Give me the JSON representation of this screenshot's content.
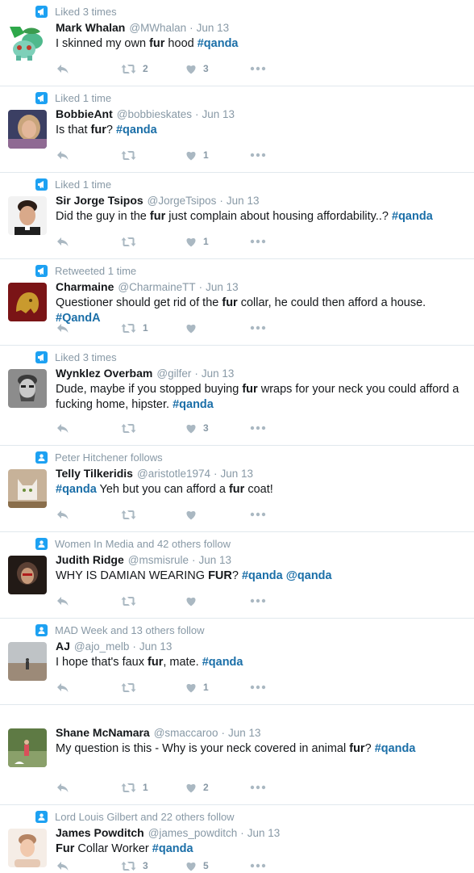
{
  "colors": {
    "accent": "#1da1f2",
    "hashtag": "#1b6fa8",
    "muted": "#8899a6",
    "icon": "#aab8c2"
  },
  "tweets": [
    {
      "context_icon": "bullhorn-icon",
      "context": "Liked 3 times",
      "name": "Mark Whalan",
      "handle": "@MWhalan",
      "time": "Jun 13",
      "avatar": "bulbasaur-avatar",
      "body": [
        [
          "t",
          "I skinned my own  "
        ],
        [
          "k",
          "fur"
        ],
        [
          "t",
          " hood "
        ],
        [
          "h",
          "#qanda"
        ]
      ],
      "retweets": "2",
      "likes": "3"
    },
    {
      "context_icon": "bullhorn-icon",
      "context": "Liked 1 time",
      "name": "BobbieAnt",
      "handle": "@bobbieskates",
      "time": "Jun 13",
      "avatar": "woman-portrait-avatar",
      "body": [
        [
          "t",
          "Is that "
        ],
        [
          "k",
          "fur"
        ],
        [
          "t",
          "? "
        ],
        [
          "h",
          "#qanda"
        ]
      ],
      "retweets": "",
      "likes": "1"
    },
    {
      "context_icon": "bullhorn-icon",
      "context": "Liked 1 time",
      "name": "Sir Jorge Tsipos",
      "handle": "@JorgeTsipos",
      "time": "Jun 13",
      "avatar": "man-portrait-avatar",
      "body": [
        [
          "t",
          "Did the guy in the "
        ],
        [
          "k",
          "fur"
        ],
        [
          "t",
          " just complain about housing affordability..? "
        ],
        [
          "h",
          "#qanda"
        ]
      ],
      "retweets": "",
      "likes": "1"
    },
    {
      "context_icon": "bullhorn-icon",
      "context": "Retweeted 1 time",
      "name": "Charmaine",
      "handle": "@CharmaineTT",
      "time": "Jun 13",
      "avatar": "gold-mask-avatar",
      "body": [
        [
          "t",
          "Questioner should get rid of the "
        ],
        [
          "k",
          "fur"
        ],
        [
          "t",
          " collar, he could then afford a house. "
        ],
        [
          "h",
          "#QandA"
        ]
      ],
      "retweets": "1",
      "likes": ""
    },
    {
      "context_icon": "bullhorn-icon",
      "context": "Liked 3 times",
      "name": "Wynklez Overbam",
      "handle": "@gilfer",
      "time": "Jun 13",
      "avatar": "bearded-man-avatar",
      "body": [
        [
          "t",
          "Dude, maybe if you stopped buying "
        ],
        [
          "k",
          "fur"
        ],
        [
          "t",
          " wraps for your neck you could afford a fucking home, hipster. "
        ],
        [
          "h",
          "#qanda"
        ]
      ],
      "retweets": "",
      "likes": "3"
    },
    {
      "context_icon": "person-icon",
      "context": "Peter Hitchener follows",
      "name": "Telly Tilkeridis",
      "handle": "@aristotle1974",
      "time": "Jun 13",
      "avatar": "cat-avatar",
      "body": [
        [
          "h",
          "#qanda"
        ],
        [
          "t",
          " Yeh but you can afford a "
        ],
        [
          "k",
          "fur"
        ],
        [
          "t",
          " coat!"
        ]
      ],
      "retweets": "",
      "likes": ""
    },
    {
      "context_icon": "person-icon",
      "context": "Women In Media and 42 others follow",
      "name": "Judith Ridge",
      "handle": "@msmisrule",
      "time": "Jun 13",
      "avatar": "woman-dark-avatar",
      "body": [
        [
          "t",
          "WHY IS DAMIAN WEARING "
        ],
        [
          "k",
          "FUR"
        ],
        [
          "t",
          "? "
        ],
        [
          "h",
          "#qanda"
        ],
        [
          "t",
          " "
        ],
        [
          "h",
          "@qanda"
        ]
      ],
      "retweets": "",
      "likes": ""
    },
    {
      "context_icon": "person-icon",
      "context": "MAD Week and 13 others follow",
      "name": "AJ",
      "handle": "@ajo_melb",
      "time": "Jun 13",
      "avatar": "beach-avatar",
      "body": [
        [
          "t",
          "I hope that's faux "
        ],
        [
          "k",
          "fur"
        ],
        [
          "t",
          ", mate. "
        ],
        [
          "h",
          "#qanda"
        ]
      ],
      "retweets": "",
      "likes": "1"
    },
    {
      "context_icon": "person-icon",
      "context": "",
      "name": "Shane McNamara",
      "handle": "@smaccaroo",
      "time": "Jun 13",
      "avatar": "park-avatar",
      "body": [
        [
          "t",
          "My question is this - Why is your neck covered in animal "
        ],
        [
          "k",
          "fur"
        ],
        [
          "t",
          "? "
        ],
        [
          "h",
          "#qanda"
        ]
      ],
      "retweets": "1",
      "likes": "2"
    },
    {
      "context_icon": "person-icon",
      "context": "Lord Louis Gilbert and 22 others follow",
      "name": "James Powditch",
      "handle": "@james_powditch",
      "time": "Jun 13",
      "avatar": "man-pale-avatar",
      "body": [
        [
          "k",
          "Fur"
        ],
        [
          "t",
          " Collar Worker "
        ],
        [
          "h",
          "#qanda"
        ]
      ],
      "retweets": "3",
      "likes": "5"
    }
  ]
}
